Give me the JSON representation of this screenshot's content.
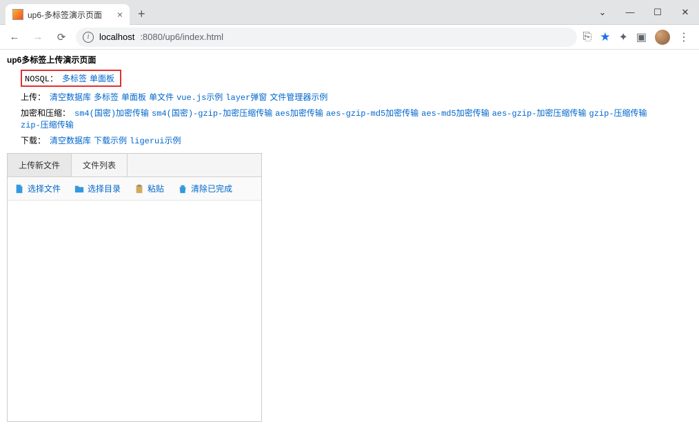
{
  "window": {
    "tab_title": "up6-多标签演示页面",
    "close_glyph": "×",
    "newtab_glyph": "+",
    "controls": {
      "chevron": "⌄",
      "minimize": "—",
      "maximize": "☐",
      "close": "✕"
    }
  },
  "addressbar": {
    "back": "←",
    "forward": "→",
    "reload": "⟳",
    "host": "localhost",
    "port_path": ":8080/up6/index.html",
    "share": "⎘",
    "star": "★",
    "extensions": "✦",
    "sidepanel": "▣",
    "menu": "⋮"
  },
  "page": {
    "title": "up6多标签上传演示页面",
    "rows": [
      {
        "label": "NOSQL：",
        "boxed": true,
        "links": [
          "多标签",
          "单面板"
        ]
      },
      {
        "label": "上传：",
        "links": [
          "清空数据库",
          "多标签",
          "单面板",
          "单文件",
          "vue.js示例",
          "layer弹窗",
          "文件管理器示例"
        ]
      },
      {
        "label": "加密和压缩：",
        "links": [
          "sm4(国密)加密传输",
          "sm4(国密)-gzip-加密压缩传输",
          "aes加密传输",
          "aes-gzip-md5加密传输",
          "aes-md5加密传输",
          "aes-gzip-加密压缩传输",
          "gzip-压缩传输",
          "zip-压缩传输"
        ]
      },
      {
        "label": "下载：",
        "links": [
          "清空数据库",
          "下载示例",
          "ligerui示例"
        ]
      }
    ]
  },
  "panel": {
    "tabs": [
      "上传新文件",
      "文件列表"
    ],
    "active_tab": 0,
    "tools": [
      {
        "label": "选择文件",
        "icon": "file-icon"
      },
      {
        "label": "选择目录",
        "icon": "folder-icon"
      },
      {
        "label": "粘贴",
        "icon": "paste-icon"
      },
      {
        "label": "清除已完成",
        "icon": "clear-icon"
      }
    ]
  }
}
